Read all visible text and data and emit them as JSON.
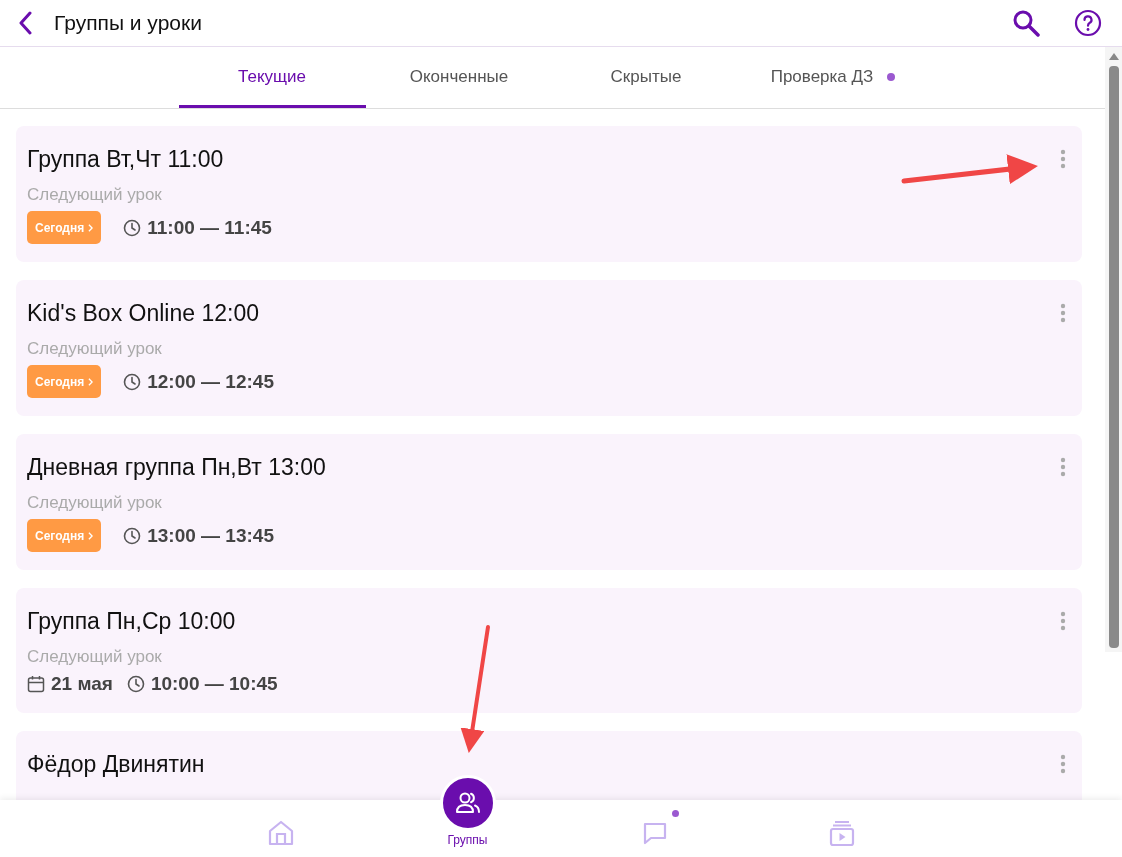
{
  "header": {
    "title": "Группы и уроки"
  },
  "tabs": [
    {
      "label": "Текущие",
      "selected": true,
      "dot": false
    },
    {
      "label": "Оконченные",
      "selected": false,
      "dot": false
    },
    {
      "label": "Скрытые",
      "selected": false,
      "dot": false
    },
    {
      "label": "Проверка ДЗ",
      "selected": false,
      "dot": true
    }
  ],
  "groups": [
    {
      "title": "Группа Вт,Чт 11:00",
      "subtitle": "Следующий урок",
      "kind": "today",
      "badge": "Сегодня",
      "time": "11:00 — 11:45"
    },
    {
      "title": "Kid's Box Online 12:00",
      "subtitle": "Следующий урок",
      "kind": "today",
      "badge": "Сегодня",
      "time": "12:00 — 12:45"
    },
    {
      "title": "Дневная группа Пн,Вт 13:00",
      "subtitle": "Следующий урок",
      "kind": "today",
      "badge": "Сегодня",
      "time": "13:00 — 13:45"
    },
    {
      "title": "Группа Пн,Ср 10:00",
      "subtitle": "Следующий урок",
      "kind": "date",
      "date": "21 мая",
      "time": "10:00 — 10:45"
    },
    {
      "title": "Фёдор Двинятин",
      "kind": "cut"
    }
  ],
  "bottom_nav": [
    {
      "kind": "home",
      "selected": false,
      "dot": false
    },
    {
      "kind": "groups",
      "label": "Группы",
      "selected": true,
      "dot": false
    },
    {
      "kind": "chat",
      "selected": false,
      "dot": true
    },
    {
      "kind": "video",
      "selected": false,
      "dot": false
    }
  ]
}
